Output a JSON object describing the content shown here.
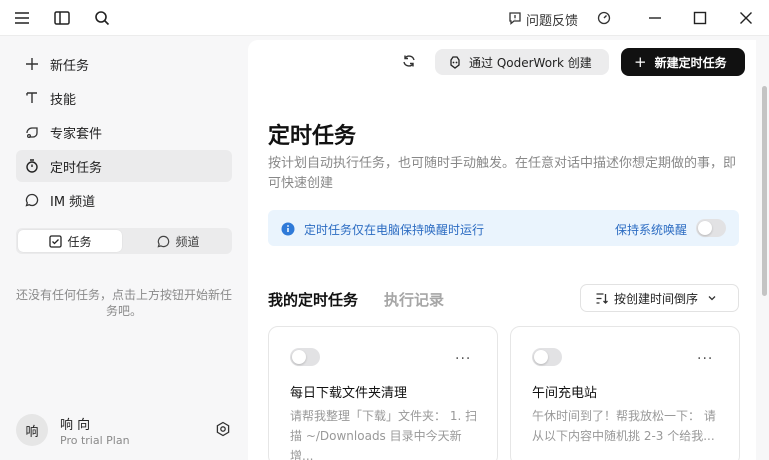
{
  "titlebar": {
    "feedback_label": "问题反馈"
  },
  "sidebar": {
    "items": [
      {
        "label": "新任务",
        "icon": "plus-icon"
      },
      {
        "label": "技能",
        "icon": "skill-icon"
      },
      {
        "label": "专家套件",
        "icon": "expert-suite-icon"
      },
      {
        "label": "定时任务",
        "icon": "timer-icon",
        "active": true
      },
      {
        "label": "IM 频道",
        "icon": "chat-icon"
      }
    ],
    "segment": {
      "tasks_label": "任务",
      "channels_label": "频道"
    },
    "empty_text": "还没有任何任务，点击上方按钮开始新任务吧。",
    "user": {
      "avatar_text": "响",
      "name": "响 向",
      "plan": "Pro trial Plan"
    }
  },
  "header": {
    "qoder_button": "通过 QoderWork 创建",
    "new_button": "新建定时任务"
  },
  "page": {
    "title": "定时任务",
    "description": "按计划自动执行任务，也可随时手动触发。在任意对话中描述你想定期做的事，即可快速创建",
    "banner_text": "定时任务仅在电脑保持唤醒时运行",
    "banner_keep_awake": "保持系统唤醒",
    "tab_mine": "我的定时任务",
    "tab_log": "执行记录",
    "sort_label": "按创建时间倒序"
  },
  "cards": [
    {
      "title": "每日下载文件夹清理",
      "desc_line1": "请帮我整理「下载」文件夹： 1. 扫",
      "desc_line2": "描 ~/Downloads 目录中今天新增...",
      "enabled": false
    },
    {
      "title": "午间充电站",
      "desc_line1": "午休时间到了！帮我放松一下： 请",
      "desc_line2": "从以下内容中随机挑 2-3 个给我...",
      "enabled": false
    }
  ],
  "colors": {
    "accent_dark": "#111111",
    "banner_bg": "#eaf4fd",
    "banner_text": "#2c6cc2"
  }
}
